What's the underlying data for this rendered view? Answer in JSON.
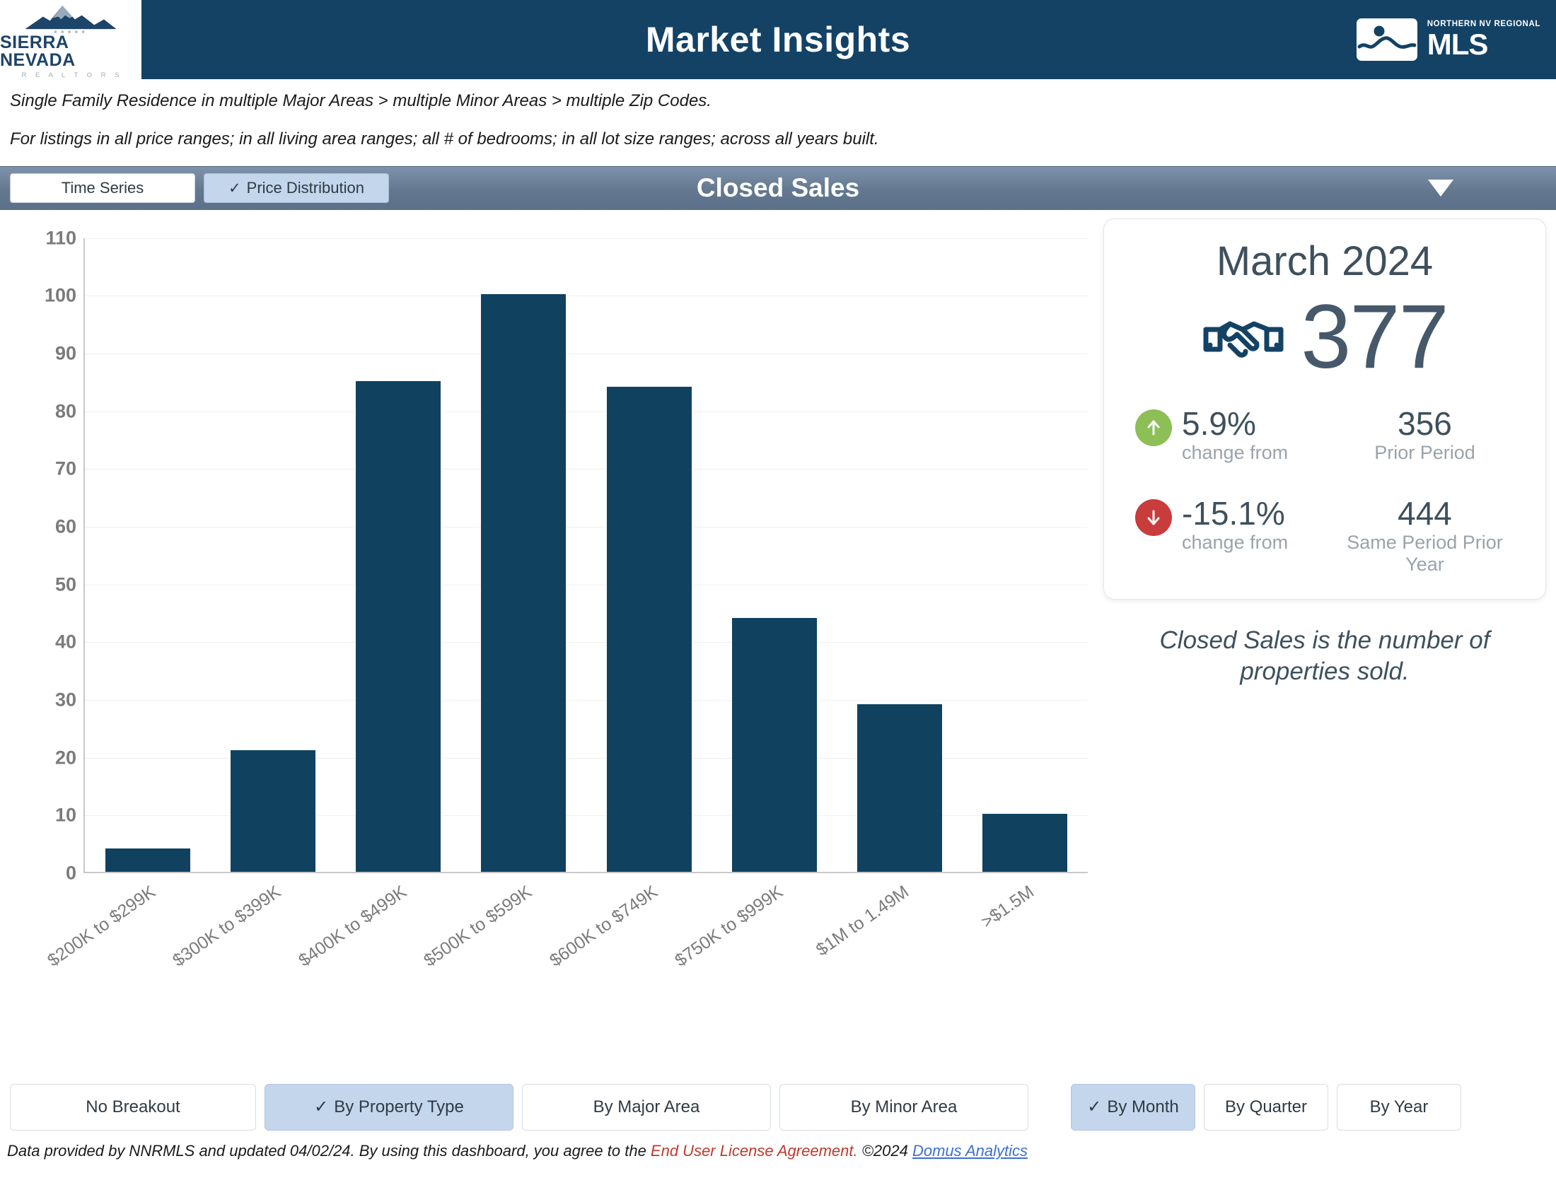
{
  "header": {
    "title": "Market Insights",
    "left_logo": {
      "name": "SIERRA NEVADA",
      "subtitle": "R E A L T O R S"
    },
    "right_logo": {
      "top": "NORTHERN NV REGIONAL",
      "main": "MLS"
    }
  },
  "filters": {
    "line1": "Single Family Residence in multiple Major Areas > multiple Minor Areas > multiple Zip Codes.",
    "line2": "For listings in all price ranges; in all living area ranges; all # of bedrooms; in all lot size ranges; across all years built."
  },
  "toolbar": {
    "tabs": [
      {
        "label": "Time Series",
        "selected": false
      },
      {
        "label": "Price Distribution",
        "selected": true
      }
    ],
    "title": "Closed Sales",
    "check_glyph": "✓",
    "caret": "dropdown-caret"
  },
  "stat_card": {
    "month": "March 2024",
    "icon": "handshake-icon",
    "value": "377",
    "rows": [
      {
        "direction": "up",
        "arrow_color": "#8cbf56",
        "pct": "5.9%",
        "pct_sub": "change from",
        "number": "356",
        "number_sub": "Prior Period"
      },
      {
        "direction": "down",
        "arrow_color": "#c93c3c",
        "pct": "-15.1%",
        "pct_sub": "change from",
        "number": "444",
        "number_sub": "Same Period Prior Year"
      }
    ],
    "note": "Closed Sales is the number of properties sold."
  },
  "breakouts": {
    "check_glyph": "✓",
    "buttons": [
      {
        "label": "No Breakout",
        "selected": false
      },
      {
        "label": "By Property Type",
        "selected": true
      },
      {
        "label": "By Major Area",
        "selected": false
      },
      {
        "label": "By Minor Area",
        "selected": false
      }
    ],
    "period_buttons": [
      {
        "label": "By Month",
        "selected": true
      },
      {
        "label": "By Quarter",
        "selected": false
      },
      {
        "label": "By Year",
        "selected": false
      }
    ]
  },
  "footer": {
    "text_before": "Data provided by NNRMLS and updated 04/02/24.  By using this dashboard, you agree to the ",
    "eula": "End User License Agreement.",
    "copyright": "  ©2024 ",
    "domus": "Domus Analytics"
  },
  "chart_data": {
    "type": "bar",
    "title": "Closed Sales",
    "xlabel": "",
    "ylabel": "",
    "ylim": [
      0,
      110
    ],
    "yticks": [
      0,
      10,
      20,
      30,
      40,
      50,
      60,
      70,
      80,
      90,
      100,
      110
    ],
    "grid": true,
    "legend": "none",
    "bar_color": "#104260",
    "categories": [
      "$200K to $299K",
      "$300K to $399K",
      "$400K to $499K",
      "$500K to $599K",
      "$600K to $749K",
      "$750K to $999K",
      "$1M to 1.49M",
      ">$1.5M"
    ],
    "values": [
      4,
      21,
      85,
      100,
      84,
      44,
      29,
      10
    ]
  }
}
